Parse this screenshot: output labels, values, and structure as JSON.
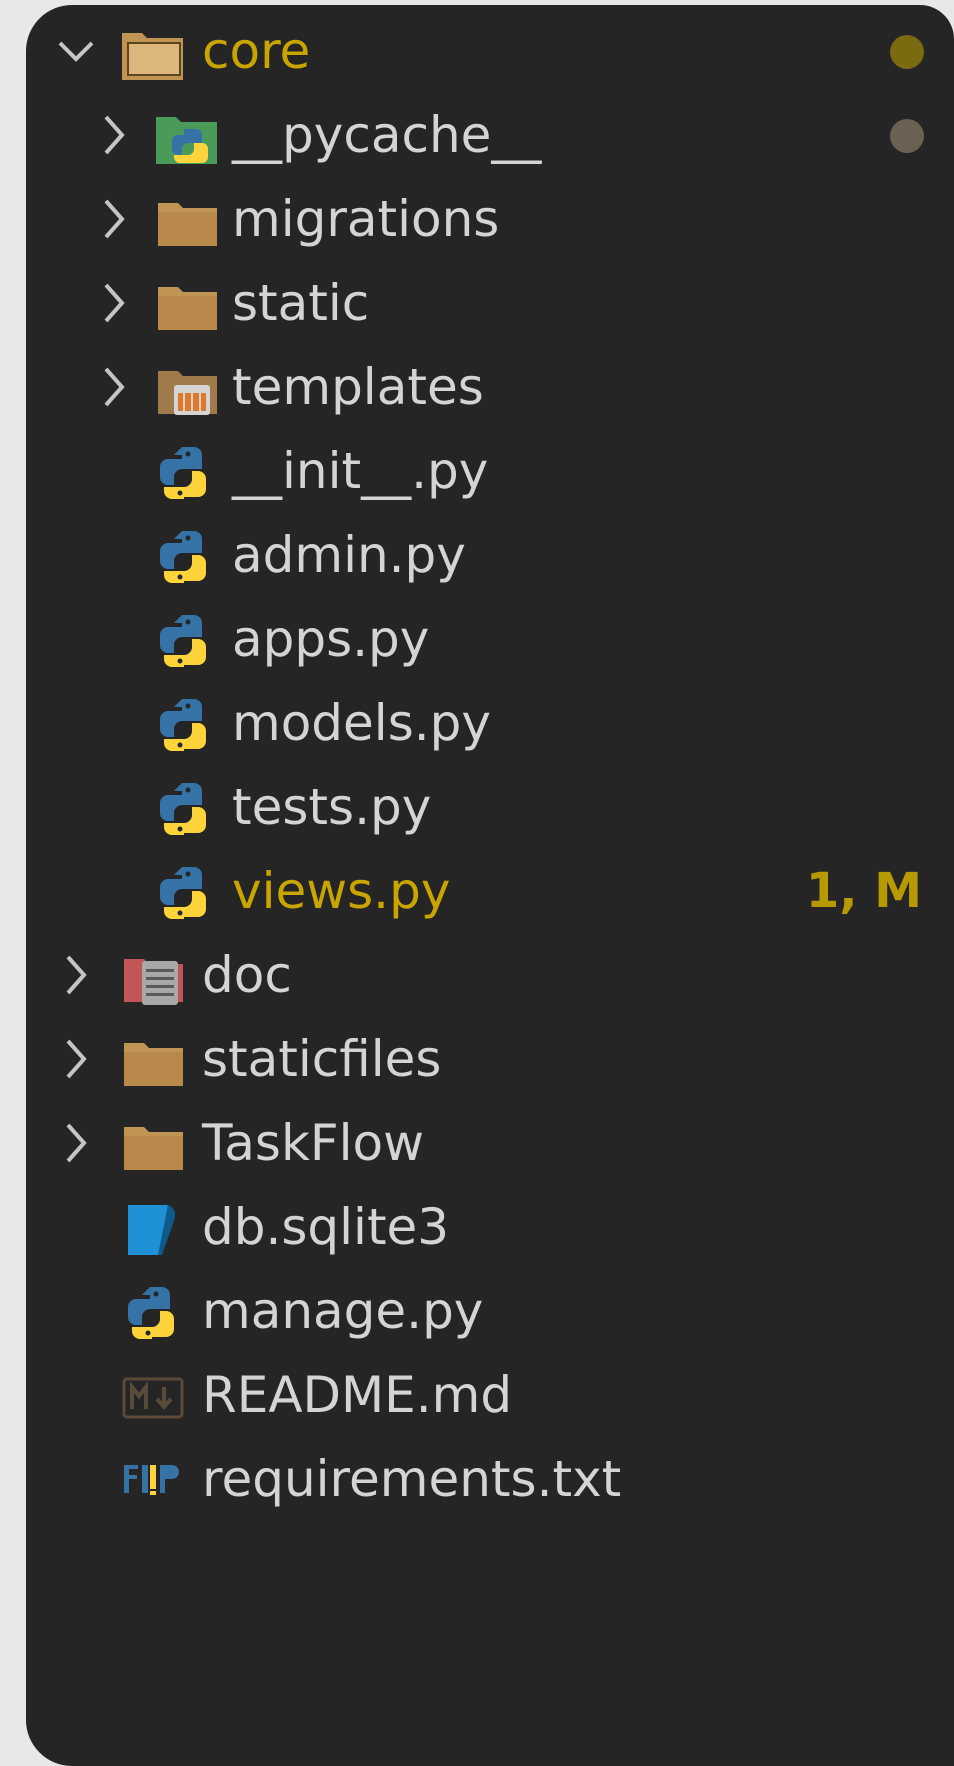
{
  "explorer": {
    "root": {
      "label": "core",
      "expanded": true
    },
    "core_children": [
      {
        "label": "__pycache__",
        "icon": "python-folder-icon",
        "type": "folder"
      },
      {
        "label": "migrations",
        "icon": "folder-icon",
        "type": "folder"
      },
      {
        "label": "static",
        "icon": "folder-icon",
        "type": "folder"
      },
      {
        "label": "templates",
        "icon": "templates-folder-icon",
        "type": "folder"
      },
      {
        "label": "__init__.py",
        "icon": "python-icon",
        "type": "file"
      },
      {
        "label": "admin.py",
        "icon": "python-icon",
        "type": "file"
      },
      {
        "label": "apps.py",
        "icon": "python-icon",
        "type": "file"
      },
      {
        "label": "models.py",
        "icon": "python-icon",
        "type": "file"
      },
      {
        "label": "tests.py",
        "icon": "python-icon",
        "type": "file"
      },
      {
        "label": "views.py",
        "icon": "python-icon",
        "type": "file",
        "badge": "1, M"
      }
    ],
    "top_items": [
      {
        "label": "doc",
        "icon": "doc-folder-icon",
        "type": "folder"
      },
      {
        "label": "staticfiles",
        "icon": "folder-icon",
        "type": "folder"
      },
      {
        "label": "TaskFlow",
        "icon": "folder-icon",
        "type": "folder"
      },
      {
        "label": "db.sqlite3",
        "icon": "database-icon",
        "type": "file"
      },
      {
        "label": "manage.py",
        "icon": "python-icon",
        "type": "file"
      },
      {
        "label": "README.md",
        "icon": "markdown-icon",
        "type": "file"
      },
      {
        "label": "requirements.txt",
        "icon": "requirements-icon",
        "type": "file"
      }
    ]
  },
  "colors": {
    "background": "#252526",
    "text": "#d4d4d4",
    "modified": "#c9a500",
    "folder": "#c09553",
    "python_blue": "#3572a5",
    "python_yellow": "#ffd43b"
  }
}
